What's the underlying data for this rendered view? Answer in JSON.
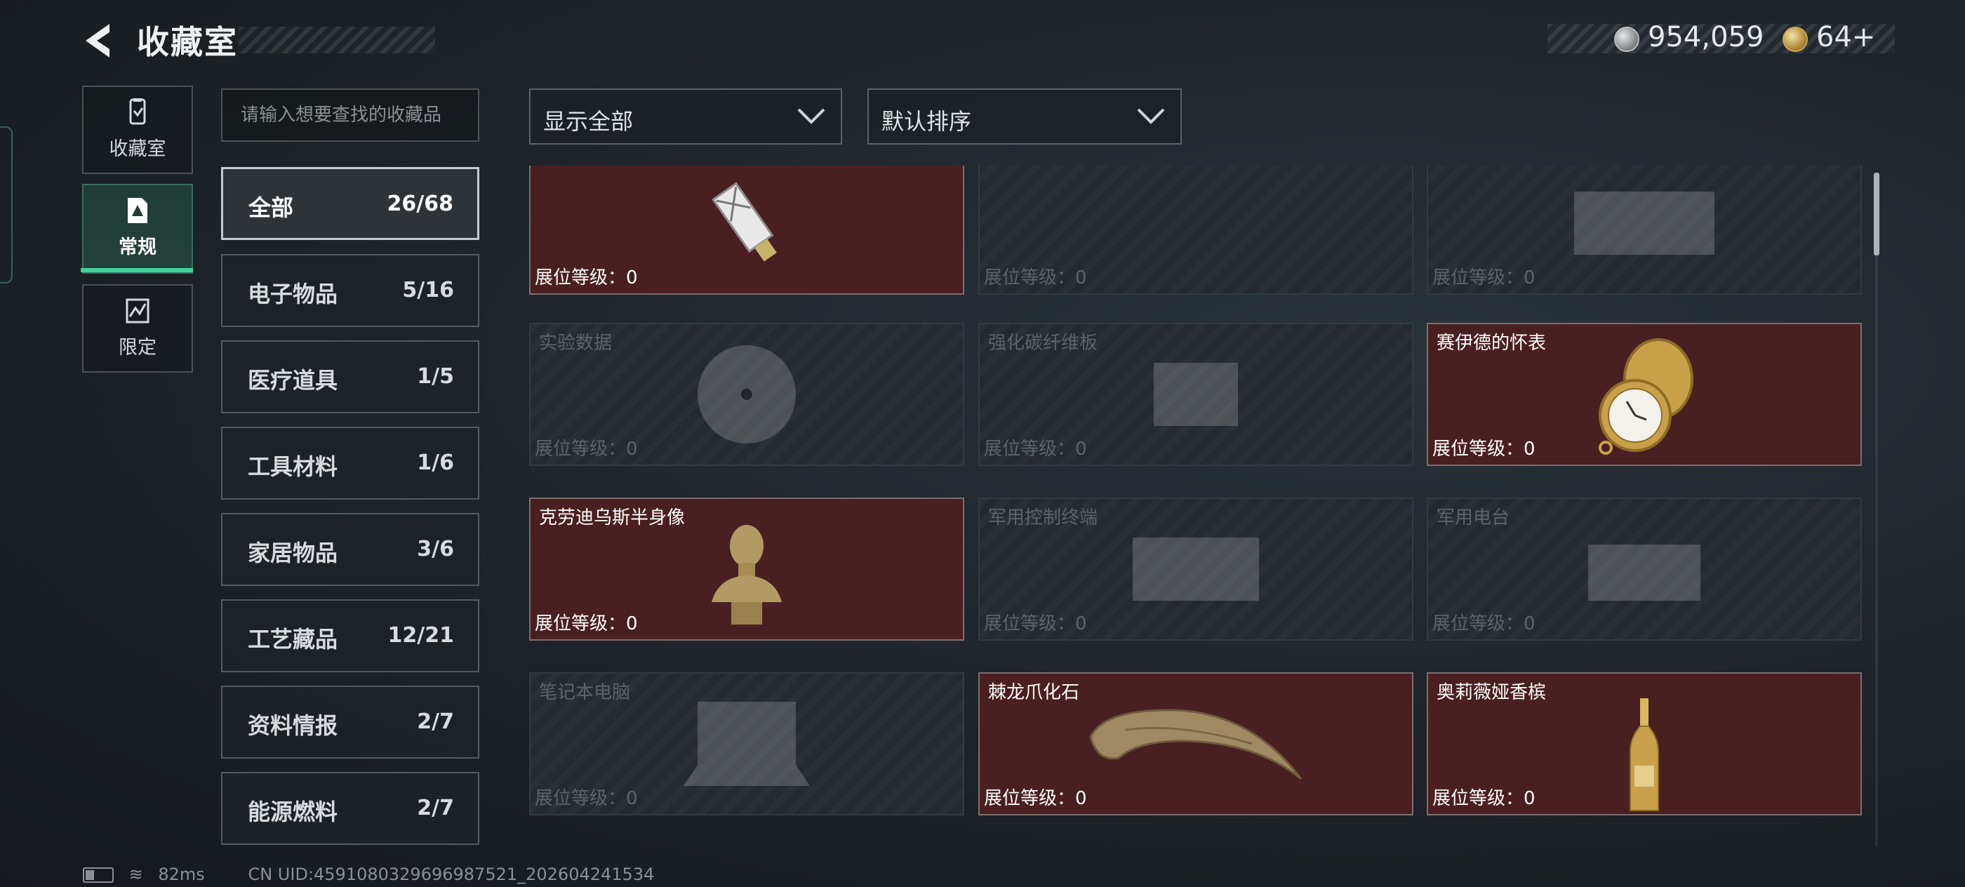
{
  "header": {
    "title": "收藏室",
    "money": "954,059",
    "tokens": "64",
    "plus": "+"
  },
  "side_tabs": [
    {
      "label": "收藏室",
      "icon": "collection-icon"
    },
    {
      "label": "常规",
      "icon": "regular-doc-icon",
      "selected": true
    },
    {
      "label": "限定",
      "icon": "limited-icon"
    }
  ],
  "search": {
    "placeholder": "请输入想要查找的收藏品"
  },
  "categories": [
    {
      "name": "全部",
      "count": "26/68",
      "active": true
    },
    {
      "name": "电子物品",
      "count": "5/16"
    },
    {
      "name": "医疗道具",
      "count": "1/5"
    },
    {
      "name": "工具材料",
      "count": "1/6"
    },
    {
      "name": "家居物品",
      "count": "3/6"
    },
    {
      "name": "工艺藏品",
      "count": "12/21"
    },
    {
      "name": "资料情报",
      "count": "2/7"
    },
    {
      "name": "能源燃料",
      "count": "2/7"
    }
  ],
  "filters": {
    "display": "显示全部",
    "sort": "默认排序"
  },
  "level_label": "展位等级：",
  "items": [
    {
      "name": "",
      "level": "0",
      "owned": true,
      "icon": "usb-key-icon"
    },
    {
      "name": "",
      "level": "0",
      "owned": false,
      "icon": "item-icon"
    },
    {
      "name": "",
      "level": "0",
      "owned": false,
      "icon": "device-icon"
    },
    {
      "name": "实验数据",
      "level": "0",
      "owned": false,
      "icon": "disc-icon"
    },
    {
      "name": "强化碳纤维板",
      "level": "0",
      "owned": false,
      "icon": "panel-icon"
    },
    {
      "name": "赛伊德的怀表",
      "level": "0",
      "owned": true,
      "icon": "pocket-watch-icon"
    },
    {
      "name": "克劳迪乌斯半身像",
      "level": "0",
      "owned": true,
      "icon": "bust-icon"
    },
    {
      "name": "军用控制终端",
      "level": "0",
      "owned": false,
      "icon": "terminal-icon"
    },
    {
      "name": "军用电台",
      "level": "0",
      "owned": false,
      "icon": "radio-icon"
    },
    {
      "name": "笔记本电脑",
      "level": "0",
      "owned": false,
      "icon": "laptop-icon"
    },
    {
      "name": "棘龙爪化石",
      "level": "0",
      "owned": true,
      "icon": "claw-fossil-icon"
    },
    {
      "name": "奥莉薇娅香槟",
      "level": "0",
      "owned": true,
      "icon": "champagne-icon"
    }
  ],
  "status": {
    "ping": "82ms",
    "uid": "CN UID:4591080329696987521_202604241534"
  },
  "colors": {
    "accent": "#3fd39c",
    "owned_card": "#4a1f22",
    "gold": "#c9a653"
  }
}
